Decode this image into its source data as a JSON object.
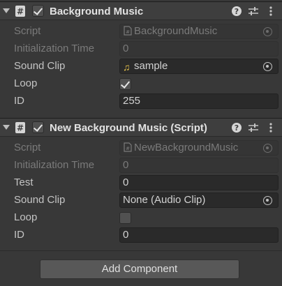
{
  "components": [
    {
      "title": "Background Music",
      "enabled": true,
      "fields": [
        {
          "label": "Script",
          "value": "BackgroundMusic",
          "disabled": true,
          "type": "object-script"
        },
        {
          "label": "Initialization Time",
          "value": "0",
          "disabled": true,
          "type": "text"
        },
        {
          "label": "Sound Clip",
          "value": "sample",
          "disabled": false,
          "type": "object-audio"
        },
        {
          "label": "Loop",
          "checked": true,
          "type": "checkbox"
        },
        {
          "label": "ID",
          "value": "255",
          "disabled": false,
          "type": "text"
        }
      ]
    },
    {
      "title": "New Background Music (Script)",
      "enabled": true,
      "fields": [
        {
          "label": "Script",
          "value": "NewBackgroundMusic",
          "disabled": true,
          "type": "object-script"
        },
        {
          "label": "Initialization Time",
          "value": "0",
          "disabled": true,
          "type": "text"
        },
        {
          "label": "Test",
          "value": "0",
          "disabled": false,
          "type": "text"
        },
        {
          "label": "Sound Clip",
          "value": "None (Audio Clip)",
          "disabled": false,
          "type": "object-none"
        },
        {
          "label": "Loop",
          "checked": false,
          "type": "checkbox"
        },
        {
          "label": "ID",
          "value": "0",
          "disabled": false,
          "type": "text"
        }
      ]
    }
  ],
  "add_component_label": "Add Component",
  "icons": {
    "foldout": "triangle-down-icon",
    "script": "script-icon",
    "help": "help-icon",
    "presets": "sliders-icon",
    "menu": "kebab-menu-icon",
    "audio": "music-note-icon",
    "picker": "object-picker-icon"
  },
  "colors": {
    "background": "#383838",
    "header": "#3e3e3e",
    "field": "#2a2a2a",
    "button": "#585858"
  }
}
